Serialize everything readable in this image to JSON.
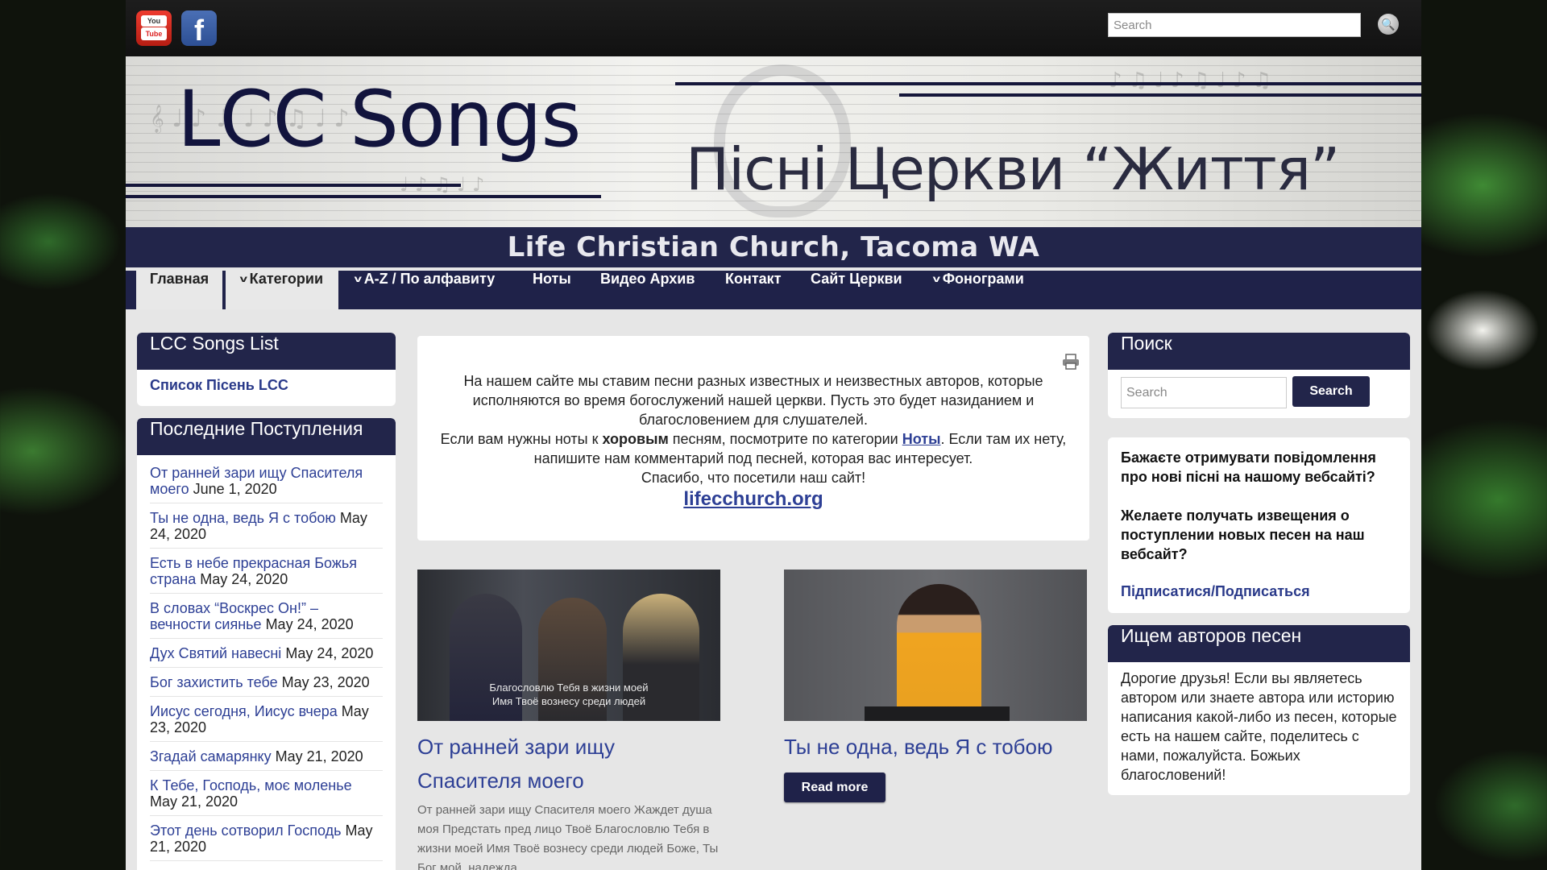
{
  "topbar": {
    "youtube_top": "You",
    "youtube_bottom": "Tube",
    "facebook": "f",
    "search_placeholder": "Search",
    "search_icon": "🔍"
  },
  "banner": {
    "site_title": "LCC Songs",
    "subtitle_ua": "Пісні Церкви “Життя”",
    "church_name": "Life Christian Church, Tacoma WA"
  },
  "nav": {
    "items": [
      {
        "label": "Главная",
        "dropdown": false
      },
      {
        "label": "Категории",
        "dropdown": true
      },
      {
        "label": "A-Z / По алфавиту",
        "dropdown": true
      },
      {
        "label": "Ноты",
        "dropdown": false
      },
      {
        "label": "Видео Архив",
        "dropdown": false
      },
      {
        "label": "Контакт",
        "dropdown": false
      },
      {
        "label": "Сайт Церкви",
        "dropdown": false
      },
      {
        "label": "Фонограми",
        "dropdown": true
      }
    ],
    "chevron": "v"
  },
  "left": {
    "songs_list": {
      "title": "LCC Songs List",
      "link": "Список Пісень LCC"
    },
    "recent": {
      "title": "Последние Поступления",
      "items": [
        {
          "title": "От ранней зари ищу Спасителя моего",
          "date": "June 1, 2020"
        },
        {
          "title": "Ты не одна, ведь Я с тобою",
          "date": "May 24, 2020"
        },
        {
          "title": "Есть в небе прекрасная Божья страна",
          "date": "May 24, 2020"
        },
        {
          "title": "В словах “Воскрес Он!” – вечности сиянье",
          "date": "May 24, 2020"
        },
        {
          "title": "Дух Святий навесні",
          "date": "May 24, 2020"
        },
        {
          "title": "Бог захистить тебе",
          "date": "May 23, 2020"
        },
        {
          "title": "Иисус сегодня, Иисус вчера",
          "date": "May 23, 2020"
        },
        {
          "title": "Згадай самарянку",
          "date": "May 21, 2020"
        },
        {
          "title": "К Тебе, Господь, моє моленье",
          "date": "May 21, 2020"
        },
        {
          "title": "Этот день сотворил Господь",
          "date": "May 21, 2020"
        }
      ]
    }
  },
  "intro": {
    "p1": "На нашем сайте мы ставим песни разных известных и неизвестных авторов, которые исполняются во время богослужений нашей церкви. Пусть это будет назиданием и благословением для слушателей.",
    "p2_a": "Если вам нужны ноты к ",
    "p2_bold": "хоровым",
    "p2_b": " песням, посмотрите по категории ",
    "p2_link": "Ноты",
    "p2_c": ". Если там их нету, напишите нам комментарий под песней, которая вас интересует.",
    "p3": "Спасибо, что посетили наш  сайт!",
    "site_link": "lifecchurch.org"
  },
  "posts": [
    {
      "title": "От ранней зари ищу Спасителя моего",
      "caption_line1": "Благословлю Тебя в жизни моей",
      "caption_line2": "Имя Твоё вознесу среди людей",
      "excerpt": "От ранней зари ищу Спасителя моего Жаждет душа моя Предстать пред лицо Твоё Благословлю Тебя в жизни моей Имя Твоё вознесу среди людей Боже, Ты Бог мой, надежда"
    },
    {
      "title": "Ты не одна, ведь Я с тобою",
      "read_more": "Read more"
    }
  ],
  "right": {
    "search": {
      "title": "Поиск",
      "placeholder": "Search",
      "button": "Search"
    },
    "subscribe": {
      "text_ua": "Бажаєте отримувати повідомлення про нові пісні на нашому вебсайті?",
      "text_ru": "Желаете получать извещения о поступлении новых песен на наш вебсайт?",
      "link": "Підписатися/Подписаться"
    },
    "authors": {
      "title": "Ищем авторов песен",
      "text": "Дорогие друзья! Если вы являетесь автором или знаете автора или историю написания какой-либо из песен, которые есть на нашем сайте, поделитесь с нами, пожалуйста. Божьих благословений!"
    }
  }
}
